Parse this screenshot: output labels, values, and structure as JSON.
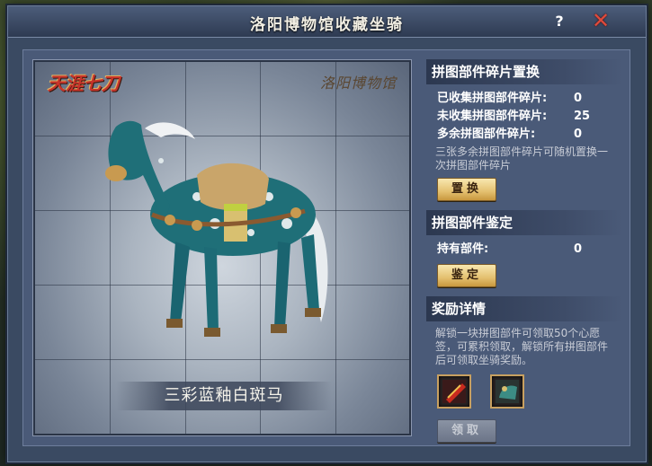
{
  "window": {
    "title": "洛阳博物馆收藏坐骑"
  },
  "controls": {
    "help": "?",
    "close": "✕"
  },
  "showcase": {
    "logo_left": "天涯七刀",
    "logo_right": "洛阳博物馆",
    "mount_name": "三彩蓝釉白斑马"
  },
  "exchange": {
    "title": "拼图部件碎片置换",
    "rows": [
      {
        "label": "已收集拼图部件碎片:",
        "value": "0"
      },
      {
        "label": "未收集拼图部件碎片:",
        "value": "25"
      },
      {
        "label": "多余拼图部件碎片:",
        "value": "0"
      }
    ],
    "desc": "三张多余拼图部件碎片可随机置换一次拼图部件碎片",
    "button": "置换"
  },
  "appraise": {
    "title": "拼图部件鉴定",
    "row": {
      "label": "持有部件:",
      "value": "0"
    },
    "button": "鉴定"
  },
  "reward": {
    "title": "奖励详情",
    "desc": "解锁一块拼图部件可领取50个心愿签，可累积领取，解锁所有拼图部件后可领取坐骑奖励。",
    "items": [
      "red-scroll-icon",
      "mount-armor-icon"
    ],
    "button": "领取"
  },
  "colors": {
    "accent": "#e4c070",
    "panel": "#4a5a78",
    "close": "#e04a3a"
  }
}
